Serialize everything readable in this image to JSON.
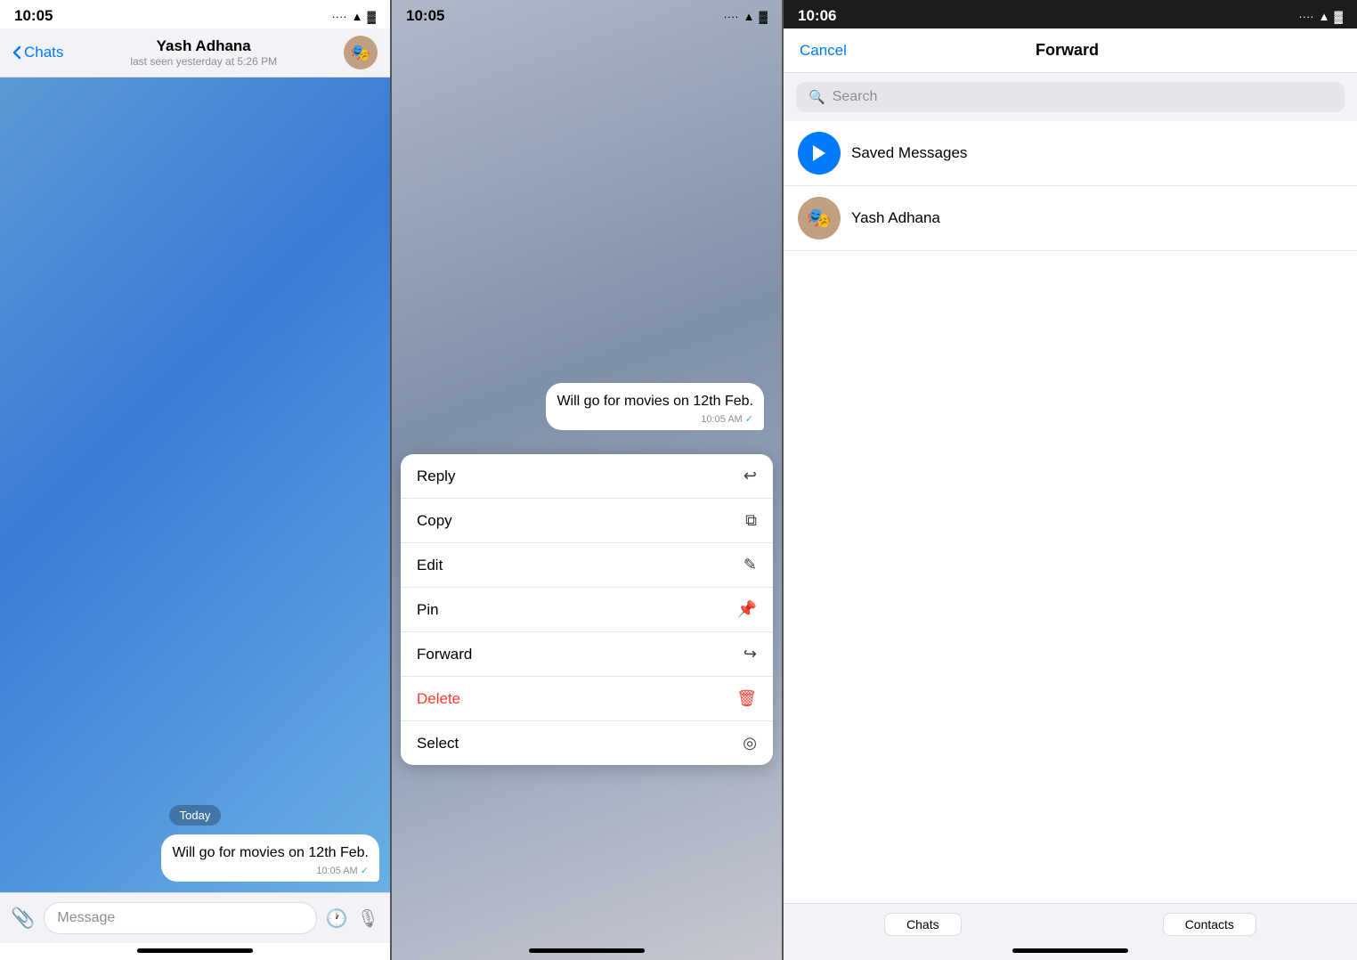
{
  "screen1": {
    "status_time": "10:05",
    "status_dots": "····",
    "nav_back": "Chats",
    "contact_name": "Yash Adhana",
    "contact_status": "last seen yesterday at 5:26 PM",
    "date_badge": "Today",
    "message_text": "Will go for movies on 12th Feb.",
    "message_time": "10:05 AM",
    "input_placeholder": "Message"
  },
  "screen2": {
    "status_time": "10:05",
    "message_text": "Will go for movies on 12th Feb.",
    "message_time": "10:05 AM",
    "context_menu": {
      "items": [
        {
          "label": "Reply",
          "icon": "↩"
        },
        {
          "label": "Copy",
          "icon": "⧉"
        },
        {
          "label": "Edit",
          "icon": "✎"
        },
        {
          "label": "Pin",
          "icon": "📌"
        },
        {
          "label": "Forward",
          "icon": "↪"
        },
        {
          "label": "Delete",
          "icon": "🗑",
          "color": "red"
        },
        {
          "label": "Select",
          "icon": "◎"
        }
      ]
    }
  },
  "screen3": {
    "status_time": "10:06",
    "nav_cancel": "Cancel",
    "nav_title": "Forward",
    "search_placeholder": "Search",
    "contacts": [
      {
        "name": "Saved Messages",
        "type": "saved"
      },
      {
        "name": "Yash Adhana",
        "type": "avatar"
      }
    ],
    "tab_chats": "Chats",
    "tab_contacts": "Contacts"
  },
  "icons": {
    "battery": "▓",
    "wifi": "▲",
    "signal": "····"
  }
}
